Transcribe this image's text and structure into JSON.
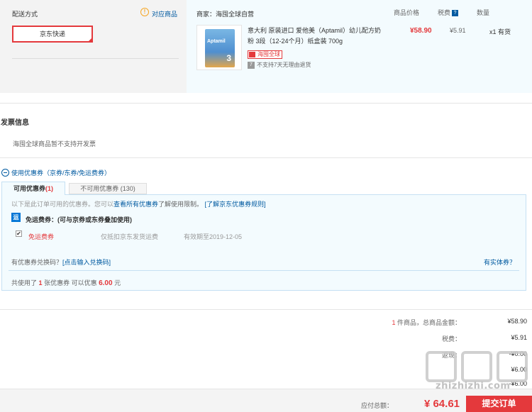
{
  "shipping": {
    "title": "配送方式",
    "warn_icon": "!",
    "warn_link": "对应商品",
    "selected_option": "京东快递"
  },
  "merchant": {
    "label": "商家：海囤全球自营",
    "col_price": "商品价格",
    "col_tax": "税费",
    "col_tax_help": "?",
    "col_qty": "数量"
  },
  "product": {
    "image_brand": "Aptamil",
    "image_stage": "3",
    "name": "意大利 原装进口 爱他美（Aptamil）幼儿配方奶粉 3段（12-24个月）纸盒装 700g",
    "price": "¥58.90",
    "tax": "¥5.91",
    "qty": "x1 有货",
    "badge_global": "海囤全球",
    "badge_return": "不支持7天无理由退货",
    "badge_return_icon": "7"
  },
  "invoice": {
    "title": "发票信息",
    "text": "海囤全球商品暂不支持开发票"
  },
  "coupon": {
    "toggle": "使用优惠券（京券/东券/免运费券）",
    "tab_available": "可用优惠券",
    "tab_available_count": "(1)",
    "tab_unavailable": "不可用优惠券 (130)",
    "info_prefix": "以下是此订单可用的优惠券。您可以",
    "info_link1": "查看所有优惠券",
    "info_mid": "了解使用限制。",
    "info_link2": "[了解京东优惠券规则]",
    "type_icon": "运",
    "type_label": "免运费券：(可与京券或东券叠加使用)",
    "check_mark": "✔",
    "item_name": "免运费券",
    "item_limit": "仅抵扣京东发货运费",
    "item_expire": "有效期至2019-12-05",
    "redeem_prefix": "有优惠券兑换码？",
    "redeem_link": "[点击输入兑换码]",
    "physical": "有实体券？",
    "summary_prefix": "共使用了",
    "summary_count": "1",
    "summary_mid": "张优惠券  可以优惠",
    "summary_amount": "6.00",
    "summary_suffix": "元"
  },
  "totals": {
    "items_count": "1",
    "items_label": "件商品，总商品金额：",
    "items_value": "¥58.90",
    "tax_label": "税费：",
    "tax_value": "¥5.91",
    "cashback_label": "返现：",
    "cashback_value": "-¥0.00",
    "freight_value": "¥6.00",
    "freight_value2": "-¥6.00",
    "payable_label": "应付总额：",
    "payable_value": "¥ 64.61",
    "submit": "提交订单"
  },
  "watermark": {
    "text": "zhizhizhi.com"
  }
}
